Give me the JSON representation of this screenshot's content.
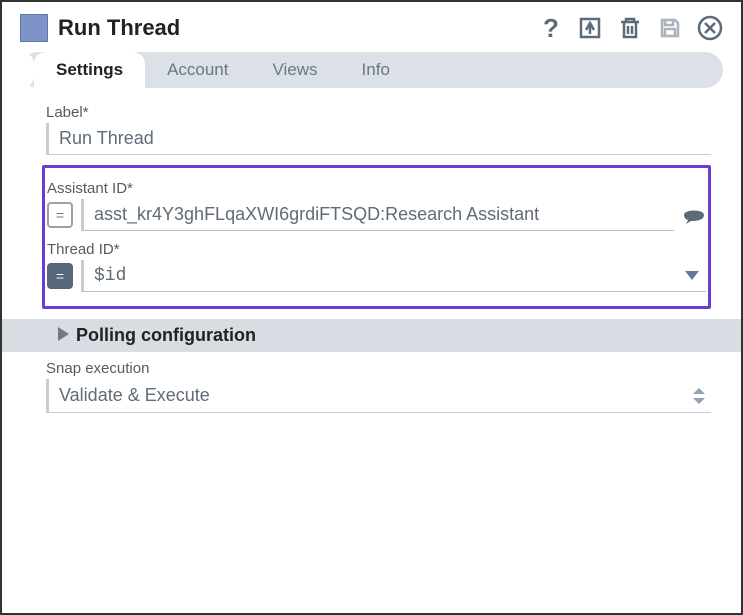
{
  "header": {
    "title": "Run Thread"
  },
  "tabs": {
    "items": [
      {
        "label": "Settings",
        "active": true
      },
      {
        "label": "Account",
        "active": false
      },
      {
        "label": "Views",
        "active": false
      },
      {
        "label": "Info",
        "active": false
      }
    ]
  },
  "fields": {
    "label": {
      "title": "Label*",
      "value": "Run Thread"
    },
    "assistant_id": {
      "title": "Assistant ID*",
      "value": "asst_kr4Y3ghFLqaXWI6grdiFTSQD:Research Assistant"
    },
    "thread_id": {
      "title": "Thread ID*",
      "value": "$id"
    },
    "snap_execution": {
      "title": "Snap execution",
      "value": "Validate & Execute"
    }
  },
  "sections": {
    "polling": {
      "label": "Polling configuration"
    }
  }
}
